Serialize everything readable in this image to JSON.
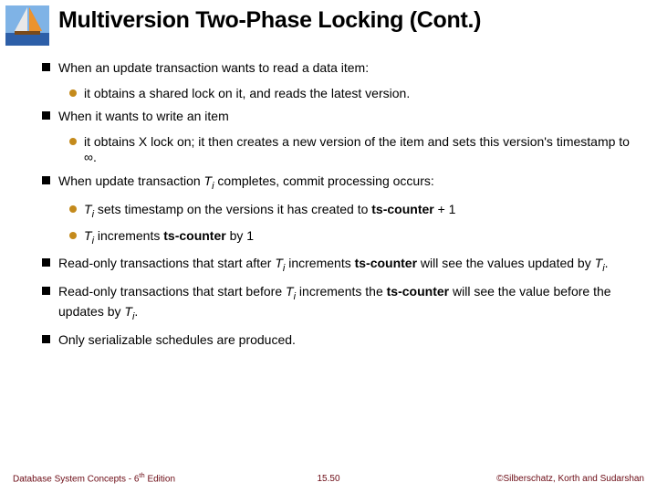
{
  "title": "Multiversion Two-Phase Locking (Cont.)",
  "p1": "When an update transaction wants to read a data item:",
  "p1a": "it obtains a shared lock on it, and reads the latest version.",
  "p2": "When it wants to write an item",
  "p2a_1": "it obtains X lock on; it then creates a new version of the item and sets this version's timestamp to ",
  "p2a_inf": "∞",
  "p2a_2": ".",
  "p3_1": "When update transaction ",
  "p3_T": "T",
  "p3_i": "i",
  "p3_2": " completes, commit processing occurs:",
  "p3a_T": "T",
  "p3a_i": "i",
  "p3a_rest": " sets timestamp on the versions it has created to  ",
  "p3a_bold": "ts-counter",
  "p3a_tail": " + 1",
  "p3b_T": "T",
  "p3b_i": "i",
  "p3b_mid": " increments  ",
  "p3b_bold": "ts-counter",
  "p3b_tail": " by 1",
  "p4_1": "Read-only transactions that start after ",
  "p4_T": "T",
  "p4_i": "i",
  "p4_2": " increments ",
  "p4_bold": "ts-counter",
  "p4_3": " will see the values updated by ",
  "p4_T2": "T",
  "p4_i2": "i",
  "p4_4": ".",
  "p5_1": "Read-only transactions that start before ",
  "p5_T": "T",
  "p5_i": "i",
  "p5_2": " increments the ",
  "p5_bold": "ts-counter",
  "p5_3": " will see the value before the updates by ",
  "p5_T2": "T",
  "p5_i2": "i",
  "p5_4": ".",
  "p6": "Only serializable schedules are produced.",
  "footer_left_1": "Database System Concepts - 6",
  "footer_left_th": "th",
  "footer_left_2": " Edition",
  "footer_center": "15.50",
  "footer_right": "©Silberschatz, Korth and Sudarshan"
}
